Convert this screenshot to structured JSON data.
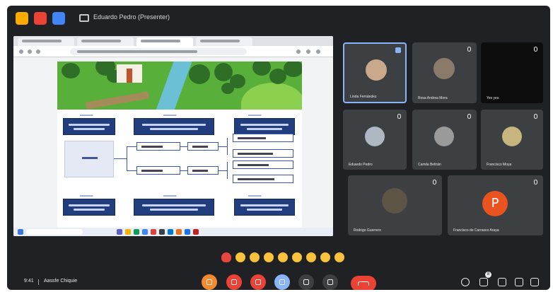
{
  "topbar": {
    "apps": [
      {
        "icon": "yellow-app-icon",
        "color": "#f9ab00"
      },
      {
        "icon": "red-app-icon",
        "color": "#ea4335"
      },
      {
        "icon": "blue-app-icon",
        "color": "#4285f4"
      }
    ],
    "presenting_text": "Eduardo Pedro (Presenter)"
  },
  "participants": [
    {
      "name": "Linda Fernández",
      "pinned": true,
      "avatar": "photo"
    },
    {
      "name": "Rosa Andrea Mora",
      "pinned": false,
      "avatar": "photo"
    },
    {
      "name": "Yes yes",
      "pinned": false,
      "avatar": "none"
    },
    {
      "name": "Eduardo Pedro",
      "pinned": false,
      "avatar": "photo"
    },
    {
      "name": "Camila Beltrán",
      "pinned": false,
      "avatar": "photo"
    },
    {
      "name": "Francisco Moya",
      "pinned": false,
      "avatar": "photo"
    },
    {
      "name": "Rodrigo Guerrero",
      "pinned": false,
      "avatar": "photo"
    },
    {
      "name": "Francisco de Carrasco Araya",
      "pinned": false,
      "avatar": "letter",
      "letter": "P"
    }
  ],
  "footer": {
    "time": "9:41",
    "meeting_code": "Aassfe Chiquie",
    "participant_count": "8"
  },
  "reactions": [
    "heart",
    "thumbs-up",
    "party",
    "clap",
    "laugh",
    "surprised",
    "sad",
    "thinking",
    "thumbs-down"
  ]
}
